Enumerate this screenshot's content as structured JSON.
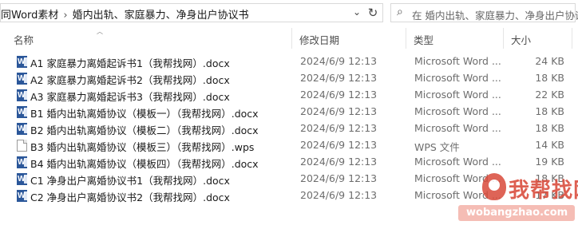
{
  "address_bar": {
    "segments": [
      "同Word素材",
      "婚内出轨、家庭暴力、净身出户协议书"
    ],
    "separator": "›",
    "dropdown_icon": "chevron-down-icon",
    "refresh_icon": "refresh-icon"
  },
  "search": {
    "icon": "search-icon",
    "placeholder": "在 婚内出轨、家庭暴力、净身出户协议书"
  },
  "columns": {
    "name": "名称",
    "modified": "修改日期",
    "type": "类型",
    "size": "大小"
  },
  "files": [
    {
      "name": "A1 家庭暴力离婚起诉书1（我帮找网）.docx",
      "modified": "2024/6/9 12:13",
      "type": "Microsoft Word ...",
      "size": "24 KB",
      "icon": "word-document-icon"
    },
    {
      "name": "A2 家庭暴力离婚起诉书2（我帮找网）.docx",
      "modified": "2024/6/9 12:13",
      "type": "Microsoft Word ...",
      "size": "18 KB",
      "icon": "word-document-icon"
    },
    {
      "name": "A3 家庭暴力离婚起诉书3（我帮找网）.docx",
      "modified": "2024/6/9 12:13",
      "type": "Microsoft Word ...",
      "size": "22 KB",
      "icon": "word-document-icon"
    },
    {
      "name": "B1 婚内出轨离婚协议（模板一）（我帮找网）.docx",
      "modified": "2024/6/9 12:13",
      "type": "Microsoft Word ...",
      "size": "18 KB",
      "icon": "word-document-icon"
    },
    {
      "name": "B2 婚内出轨离婚协议（模板二）（我帮找网）.docx",
      "modified": "2024/6/9 12:13",
      "type": "Microsoft Word ...",
      "size": "18 KB",
      "icon": "word-document-icon"
    },
    {
      "name": "B3 婚内出轨离婚协议（模板三）（我帮找网）.wps",
      "modified": "2024/6/9 12:13",
      "type": "WPS 文件",
      "size": "14 KB",
      "icon": "generic-file-icon"
    },
    {
      "name": "B4 婚内出轨离婚协议（模板四）（我帮找网）.docx",
      "modified": "2024/6/9 12:13",
      "type": "Microsoft Word ...",
      "size": "19 KB",
      "icon": "word-document-icon"
    },
    {
      "name": "C1 净身出户离婚协议书1（我帮找网）.docx",
      "modified": "2024/6/9 12:13",
      "type": "Microsoft Word ...",
      "size": "18 KB",
      "icon": "word-document-icon"
    },
    {
      "name": "C2 净身出户离婚协议书2（我帮找网）.docx",
      "modified": "2024/6/9 12:13",
      "type": "Microsoft Word ...",
      "size": "17 KB",
      "icon": "word-document-icon"
    }
  ],
  "watermark": {
    "text": "我帮找网",
    "url": "wobangzhao.com",
    "color": "#d94a3a"
  },
  "colors": {
    "word_icon": "#2b579a",
    "header_text": "#4d4d4d",
    "secondary_text": "#6d6d6d"
  }
}
